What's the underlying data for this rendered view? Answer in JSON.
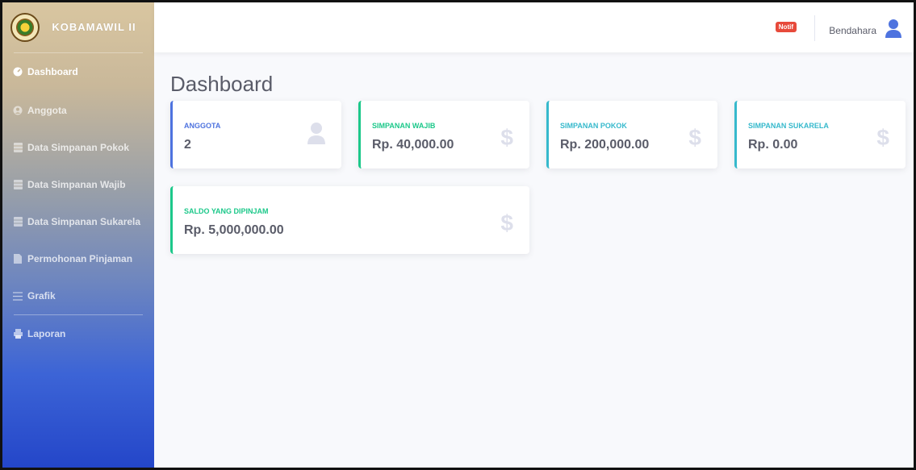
{
  "brand": {
    "name": "KOBAMAWIL II"
  },
  "sidebar": {
    "items": [
      {
        "label": "Dashboard",
        "icon": "dashboard-icon",
        "active": true
      },
      {
        "label": "Anggota",
        "icon": "user-circle-icon"
      },
      {
        "label": "Data Simpanan Pokok",
        "icon": "table-icon"
      },
      {
        "label": "Data Simpanan Wajib",
        "icon": "table-icon"
      },
      {
        "label": "Data Simpanan Sukarela",
        "icon": "table-icon"
      },
      {
        "label": "Permohonan Pinjaman",
        "icon": "file-icon"
      },
      {
        "label": "Grafik",
        "icon": "list-icon"
      },
      {
        "label": "Laporan",
        "icon": "print-icon"
      }
    ]
  },
  "topbar": {
    "notif_label": "Notif",
    "user_name": "Bendahara"
  },
  "page": {
    "title": "Dashboard"
  },
  "cards": [
    {
      "label": "ANGGOTA",
      "value": "2",
      "color": "#4e73df",
      "icon": "user-icon"
    },
    {
      "label": "SIMPANAN WAJIB",
      "value": "Rp. 40,000.00",
      "color": "#1cc88a",
      "icon": "dollar-icon"
    },
    {
      "label": "SIMPANAN POKOK",
      "value": "Rp. 200,000.00",
      "color": "#36b9cc",
      "icon": "dollar-icon"
    },
    {
      "label": "SIMPANAN SUKARELA",
      "value": "Rp. 0.00",
      "color": "#36b9cc",
      "icon": "dollar-icon"
    },
    {
      "label": "SALDO YANG DIPINJAM",
      "value": "Rp. 5,000,000.00",
      "color": "#1cc88a",
      "icon": "dollar-icon"
    }
  ]
}
